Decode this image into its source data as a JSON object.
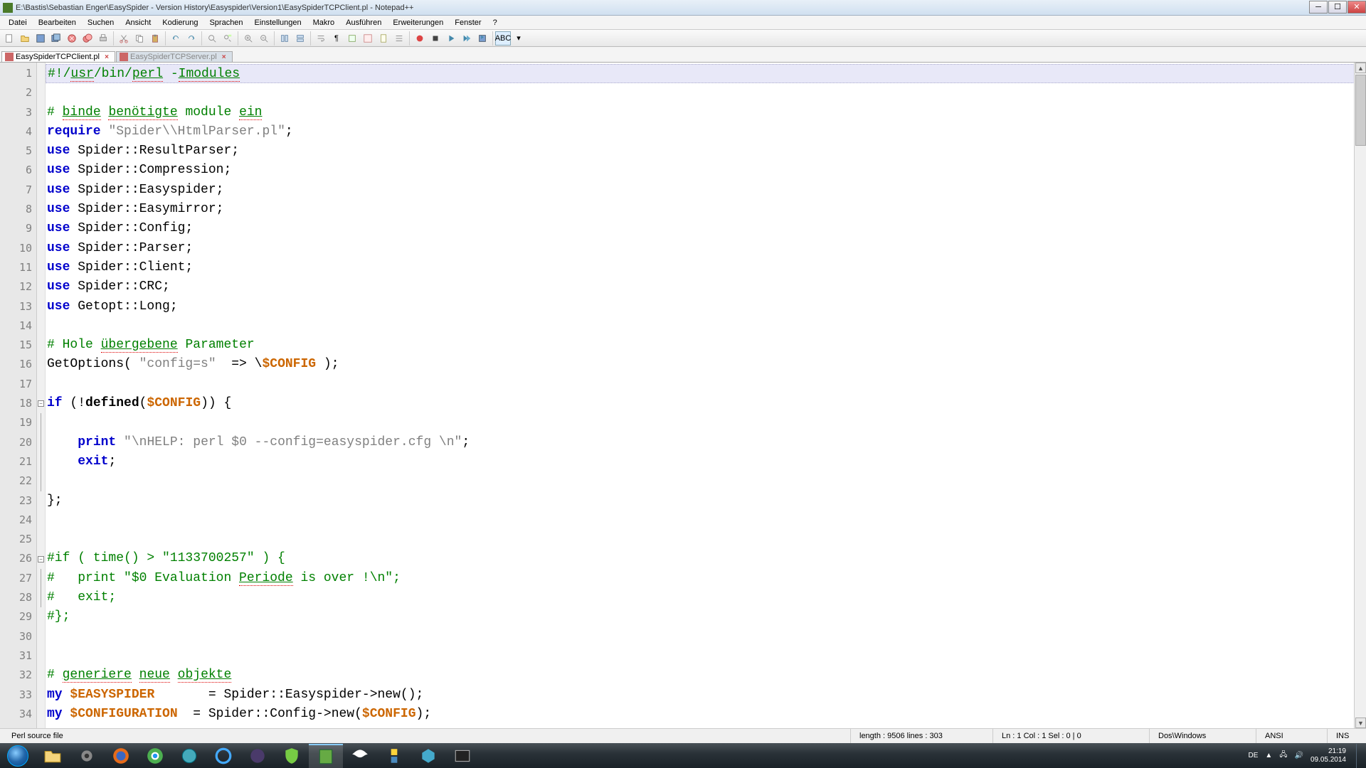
{
  "window": {
    "title": "E:\\Bastis\\Sebastian Enger\\EasySpider - Version History\\Easyspider\\Version1\\EasySpiderTCPClient.pl - Notepad++"
  },
  "menu": [
    "Datei",
    "Bearbeiten",
    "Suchen",
    "Ansicht",
    "Kodierung",
    "Sprachen",
    "Einstellungen",
    "Makro",
    "Ausführen",
    "Erweiterungen",
    "Fenster",
    "?"
  ],
  "tabs": [
    {
      "label": "EasySpiderTCPClient.pl",
      "active": true
    },
    {
      "label": "EasySpiderTCPServer.pl",
      "active": false
    }
  ],
  "code_lines": [
    {
      "n": 1,
      "class": "current",
      "html": "#!/<u class='com-u'>usr</u>/bin/<u class='com-u'>perl</u> -<u class='com-u'>Imodules</u>",
      "cls": "com"
    },
    {
      "n": 2,
      "html": ""
    },
    {
      "n": 3,
      "html": "# <u class='com-u'>binde</u> <u class='com-u'>benötigte</u> module <u class='com-u'>ein</u>",
      "cls": "com"
    },
    {
      "n": 4,
      "html": "<span class='kw'>require</span> <span class='str'>\"Spider\\\\HtmlParser.pl\"</span>;"
    },
    {
      "n": 5,
      "html": "<span class='kw'>use</span> Spider::ResultParser;"
    },
    {
      "n": 6,
      "html": "<span class='kw'>use</span> Spider::Compression;"
    },
    {
      "n": 7,
      "html": "<span class='kw'>use</span> Spider::Easyspider;"
    },
    {
      "n": 8,
      "html": "<span class='kw'>use</span> Spider::Easymirror;"
    },
    {
      "n": 9,
      "html": "<span class='kw'>use</span> Spider::Config;"
    },
    {
      "n": 10,
      "html": "<span class='kw'>use</span> Spider::Parser;"
    },
    {
      "n": 11,
      "html": "<span class='kw'>use</span> Spider::Client;"
    },
    {
      "n": 12,
      "html": "<span class='kw'>use</span> Spider::CRC;"
    },
    {
      "n": 13,
      "html": "<span class='kw'>use</span> Getopt::Long;"
    },
    {
      "n": 14,
      "html": ""
    },
    {
      "n": 15,
      "html": "# Hole <u class='com-u'>übergebene</u> Parameter",
      "cls": "com"
    },
    {
      "n": 16,
      "html": "GetOptions( <span class='str'>\"config=s\"</span>  =&gt; \\<span class='var'>$CONFIG</span> );"
    },
    {
      "n": 17,
      "html": ""
    },
    {
      "n": 18,
      "fold": "open",
      "html": "<span class='kw'>if</span> (!<span class='func'>defined</span>(<span class='var'>$CONFIG</span>)) {"
    },
    {
      "n": 19,
      "foldline": true,
      "html": ""
    },
    {
      "n": 20,
      "foldline": true,
      "html": "    <span class='kw'>print</span> <span class='str'>\"\\nHELP: perl $0 --config=easyspider.cfg \\n\"</span>;"
    },
    {
      "n": 21,
      "foldline": true,
      "html": "    <span class='kw'>exit</span>;"
    },
    {
      "n": 22,
      "foldline": true,
      "html": ""
    },
    {
      "n": 23,
      "html": "};"
    },
    {
      "n": 24,
      "html": ""
    },
    {
      "n": 25,
      "html": ""
    },
    {
      "n": 26,
      "fold": "open",
      "html": "#if ( time() &gt; \"1133700257\" ) {",
      "cls": "com"
    },
    {
      "n": 27,
      "foldline": true,
      "html": "#   print \"$0 Evaluation <u class='com-u'>Periode</u> is over !\\n\";",
      "cls": "com"
    },
    {
      "n": 28,
      "foldline": true,
      "html": "#   exit;",
      "cls": "com"
    },
    {
      "n": 29,
      "html": "#};",
      "cls": "com"
    },
    {
      "n": 30,
      "html": ""
    },
    {
      "n": 31,
      "html": ""
    },
    {
      "n": 32,
      "html": "# <u class='com-u'>generiere</u> <u class='com-u'>neue</u> <u class='com-u'>objekte</u>",
      "cls": "com"
    },
    {
      "n": 33,
      "html": "<span class='kw'>my</span> <span class='var'>$EASYSPIDER</span>       = Spider::Easyspider-&gt;new();"
    },
    {
      "n": 34,
      "html": "<span class='kw'>my</span> <span class='var'>$CONFIGURATION</span>  = Spider::Config-&gt;new(<span class='var'>$CONFIG</span>);"
    }
  ],
  "status": {
    "type": "Perl source file",
    "length": "length : 9506    lines : 303",
    "pos": "Ln : 1    Col : 1    Sel : 0 | 0",
    "eol": "Dos\\Windows",
    "enc": "ANSI",
    "ins": "INS"
  },
  "systray": {
    "lang": "DE",
    "time": "21:19",
    "date": "09.05.2014"
  }
}
